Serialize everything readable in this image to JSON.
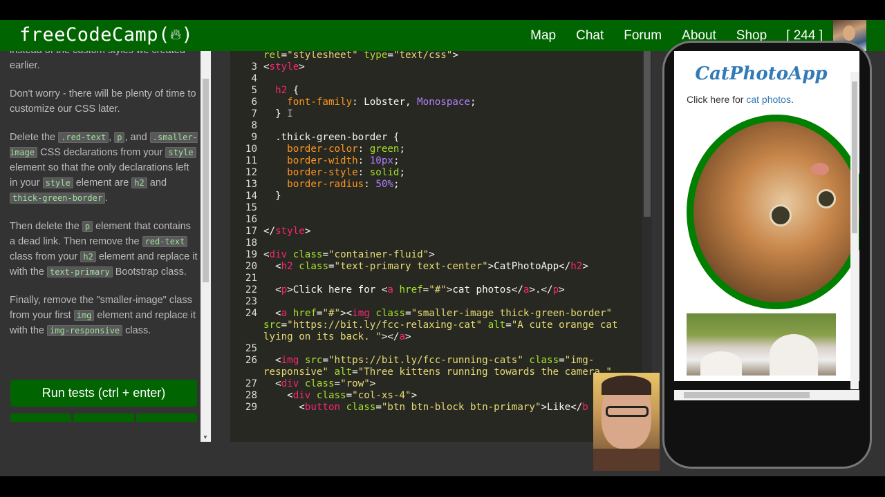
{
  "navbar": {
    "brand": "freeCodeCamp(",
    "brand_close": ")",
    "links": [
      "Map",
      "Chat",
      "Forum",
      "About",
      "Shop"
    ],
    "points": "[ 244 ]"
  },
  "instructions": {
    "p1": "instead of the custom styles we created earlier.",
    "p2": "Don't worry - there will be plenty of time to customize our CSS later.",
    "p3_a": "Delete the ",
    "p3_code1": ".red-text",
    "p3_b": ", ",
    "p3_code2": "p",
    "p3_c": ", and ",
    "p3_code3": ".smaller-image",
    "p3_d": " CSS declarations from your ",
    "p3_code4": "style",
    "p3_e": " element so that the only declarations left in your ",
    "p3_code5": "style",
    "p3_f": " element are ",
    "p3_code6": "h2",
    "p3_g": " and ",
    "p3_code7": "thick-green-border",
    "p3_h": ".",
    "p4_a": "Then delete the ",
    "p4_code1": "p",
    "p4_b": " element that contains a dead link. Then remove the ",
    "p4_code2": "red-text",
    "p4_c": " class from your ",
    "p4_code3": "h2",
    "p4_d": " element and replace it with the ",
    "p4_code4": "text-primary",
    "p4_e": " Bootstrap class.",
    "p5_a": "Finally, remove the \"smaller-image\" class from your first ",
    "p5_code1": "img",
    "p5_b": " element and replace it with the ",
    "p5_code2": "img-responsive",
    "p5_c": " class.",
    "run_button": "Run tests (ctrl + enter)"
  },
  "editor": {
    "line_numbers": [
      "",
      "3",
      "4",
      "5",
      "6",
      "7",
      "8",
      "9",
      "10",
      "11",
      "12",
      "13",
      "14",
      "15",
      "16",
      "17",
      "18",
      "19",
      "20",
      "21",
      "22",
      "23",
      "24",
      "",
      "25",
      "26",
      "",
      "27",
      "28",
      "29"
    ]
  },
  "preview": {
    "title": "CatPhotoApp",
    "text": "Click here for ",
    "link": "cat photos",
    "text_end": "."
  }
}
